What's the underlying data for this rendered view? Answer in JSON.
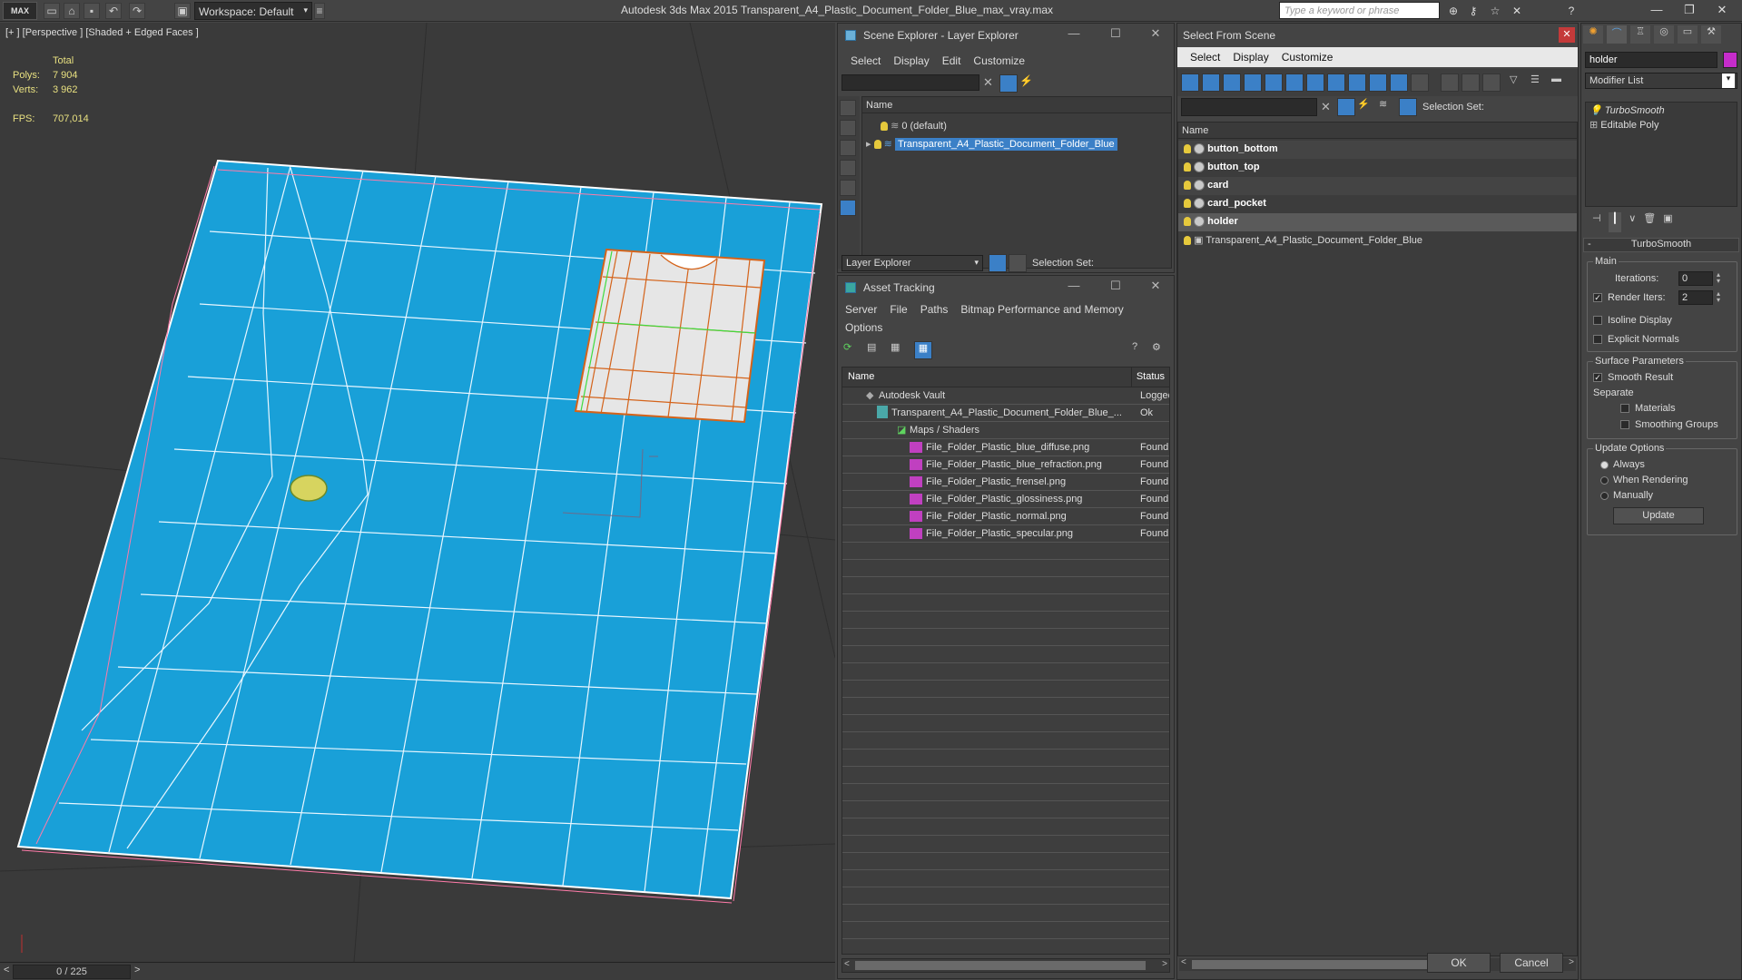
{
  "app": {
    "logo": "MAX",
    "workspace": "Workspace: Default",
    "title": "Autodesk 3ds Max  2015    Transparent_A4_Plastic_Document_Folder_Blue_max_vray.max",
    "search_placeholder": "Type a keyword or phrase"
  },
  "viewport": {
    "label": "[+ ] [Perspective ] [Shaded + Edged Faces ]",
    "stats": {
      "total": "Total",
      "polys_label": "Polys:",
      "polys": "7 904",
      "verts_label": "Verts:",
      "verts": "3 962",
      "fps_label": "FPS:",
      "fps": "707,014"
    },
    "model_color": "#19a0d8"
  },
  "timeline": {
    "frame": "0 / 225"
  },
  "scene_explorer": {
    "title": "Scene Explorer - Layer Explorer",
    "menu": [
      "Select",
      "Display",
      "Edit",
      "Customize"
    ],
    "col_name": "Name",
    "rows": [
      "0 (default)",
      "Transparent_A4_Plastic_Document_Folder_Blue"
    ],
    "footer_dropdown": "Layer Explorer",
    "selection_set": "Selection Set:"
  },
  "asset_tracking": {
    "title": "Asset Tracking",
    "menu": [
      "Server",
      "File",
      "Paths",
      "Bitmap Performance and Memory"
    ],
    "menu2": "Options",
    "col_name": "Name",
    "col_status": "Status",
    "rows": [
      {
        "name": "Autodesk Vault",
        "status": "Logged"
      },
      {
        "name": "Transparent_A4_Plastic_Document_Folder_Blue_...",
        "status": "Ok"
      },
      {
        "name": "Maps / Shaders",
        "status": ""
      },
      {
        "name": "File_Folder_Plastic_blue_diffuse.png",
        "status": "Found"
      },
      {
        "name": "File_Folder_Plastic_blue_refraction.png",
        "status": "Found"
      },
      {
        "name": "File_Folder_Plastic_frensel.png",
        "status": "Found"
      },
      {
        "name": "File_Folder_Plastic_glossiness.png",
        "status": "Found"
      },
      {
        "name": "File_Folder_Plastic_normal.png",
        "status": "Found"
      },
      {
        "name": "File_Folder_Plastic_specular.png",
        "status": "Found"
      }
    ]
  },
  "select_from_scene": {
    "title": "Select From Scene",
    "menu": [
      "Select",
      "Display",
      "Customize"
    ],
    "selection_set": "Selection Set:",
    "col_name": "Name",
    "rows": [
      "button_bottom",
      "button_top",
      "card",
      "card_pocket",
      "holder",
      "Transparent_A4_Plastic_Document_Folder_Blue"
    ],
    "ok": "OK",
    "cancel": "Cancel"
  },
  "command_panel": {
    "object_name": "holder",
    "modifier_list": "Modifier List",
    "stack": [
      "TurboSmooth",
      "Editable Poly"
    ],
    "rollout_title": "TurboSmooth",
    "main": "Main",
    "iterations_label": "Iterations:",
    "iterations": "0",
    "render_iters_label": "Render Iters:",
    "render_iters": "2",
    "isoline": "Isoline Display",
    "explicit_normals": "Explicit Normals",
    "surface_params": "Surface Parameters",
    "smooth_result": "Smooth Result",
    "separate": "Separate",
    "materials": "Materials",
    "smoothing_groups": "Smoothing Groups",
    "update_options": "Update Options",
    "always": "Always",
    "when_rendering": "When Rendering",
    "manually": "Manually",
    "update": "Update"
  }
}
